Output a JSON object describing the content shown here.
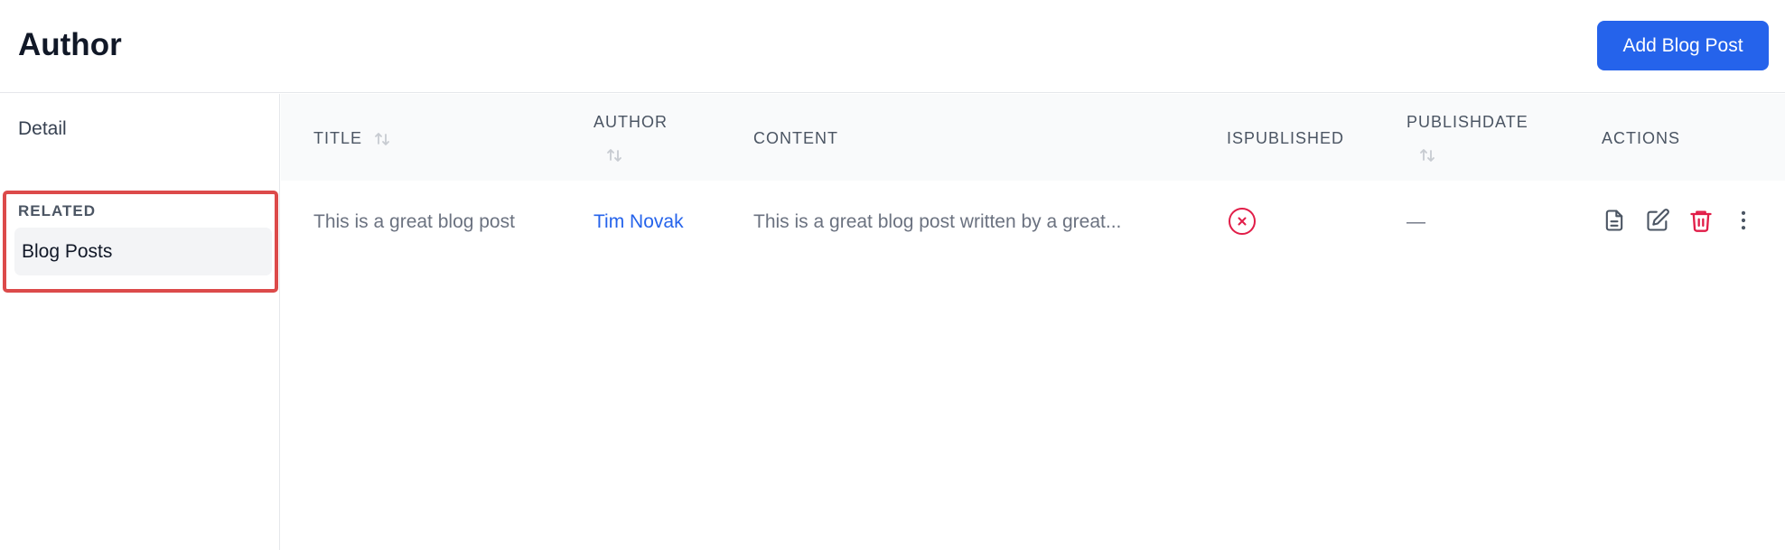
{
  "header": {
    "title": "Author",
    "add_button": "Add Blog Post"
  },
  "sidebar": {
    "detail_label": "Detail",
    "related_heading": "RELATED",
    "related_items": [
      {
        "label": "Blog Posts"
      }
    ]
  },
  "table": {
    "columns": [
      {
        "label": "TITLE",
        "sortable": true
      },
      {
        "label": "AUTHOR",
        "sortable": true
      },
      {
        "label": "CONTENT",
        "sortable": false
      },
      {
        "label": "ISPUBLISHED",
        "sortable": false
      },
      {
        "label": "PUBLISHDATE",
        "sortable": true
      },
      {
        "label": "ACTIONS",
        "sortable": false
      }
    ],
    "rows": [
      {
        "title": "This is a great blog post",
        "author": "Tim Novak",
        "content": "This is a great blog post written by a great...",
        "is_published": "false",
        "publish_date": "—",
        "actions": [
          "view-icon",
          "edit-icon",
          "delete-icon",
          "more-icon"
        ]
      }
    ]
  },
  "colors": {
    "accent": "#2563eb",
    "danger": "#e11d48",
    "highlight_border": "#dc4a4a"
  }
}
